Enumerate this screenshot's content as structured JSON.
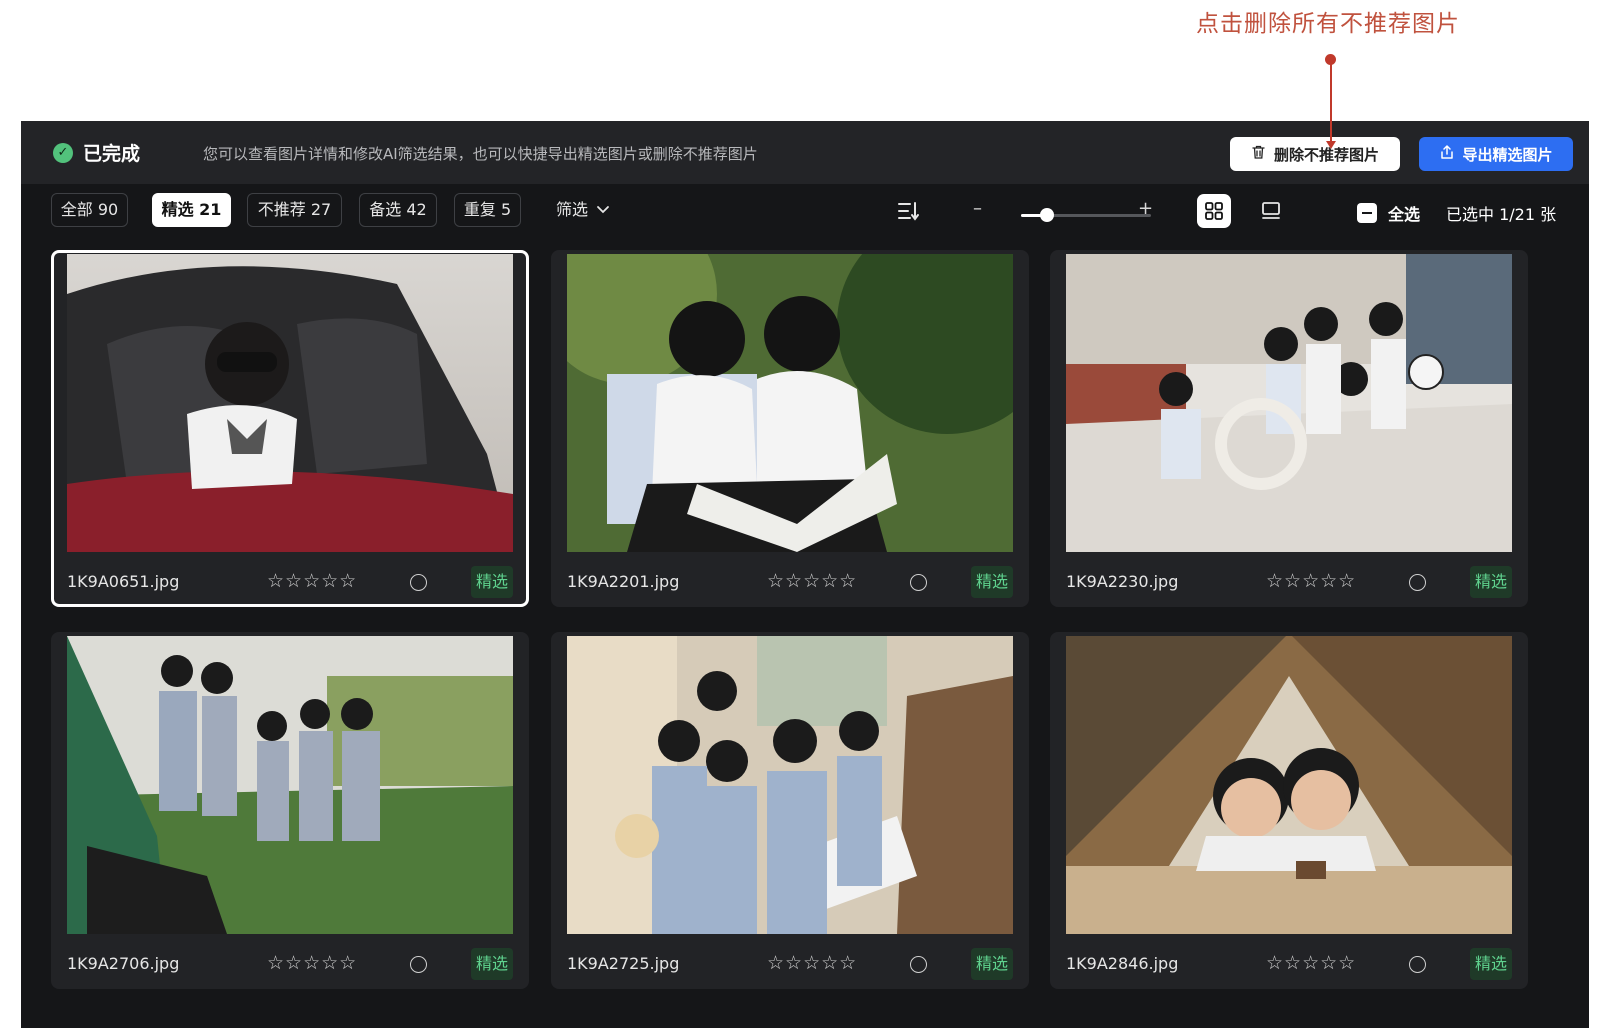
{
  "annotation": {
    "text": "点击删除所有不推荐图片"
  },
  "header": {
    "status": "已完成",
    "hint": "您可以查看图片详情和修改AI筛选结果，也可以快捷导出精选图片或删除不推荐图片",
    "delete_label": "删除不推荐图片",
    "export_label": "导出精选图片"
  },
  "tabs": [
    {
      "label": "全部 90"
    },
    {
      "label": "精选 21"
    },
    {
      "label": "不推荐 27"
    },
    {
      "label": "备选 42"
    },
    {
      "label": "重复 5"
    }
  ],
  "filter_label": "筛选",
  "zoom": {
    "minus": "–",
    "plus": "+",
    "level": 0.2
  },
  "select_all_label": "全选",
  "selected_count": "已选中 1/21 张",
  "photos": [
    {
      "name": "1K9A0651.jpg",
      "rating": "☆☆☆☆☆",
      "badge": "精选"
    },
    {
      "name": "1K9A2201.jpg",
      "rating": "☆☆☆☆☆",
      "badge": "精选"
    },
    {
      "name": "1K9A2230.jpg",
      "rating": "☆☆☆☆☆",
      "badge": "精选"
    },
    {
      "name": "1K9A2706.jpg",
      "rating": "☆☆☆☆☆",
      "badge": "精选"
    },
    {
      "name": "1K9A2725.jpg",
      "rating": "☆☆☆☆☆",
      "badge": "精选"
    },
    {
      "name": "1K9A2846.jpg",
      "rating": "☆☆☆☆☆",
      "badge": "精选"
    }
  ],
  "colors": {
    "accent": "#2d6ef2",
    "pick_green": "#5fd28e",
    "annotation_red": "#c0392b"
  }
}
